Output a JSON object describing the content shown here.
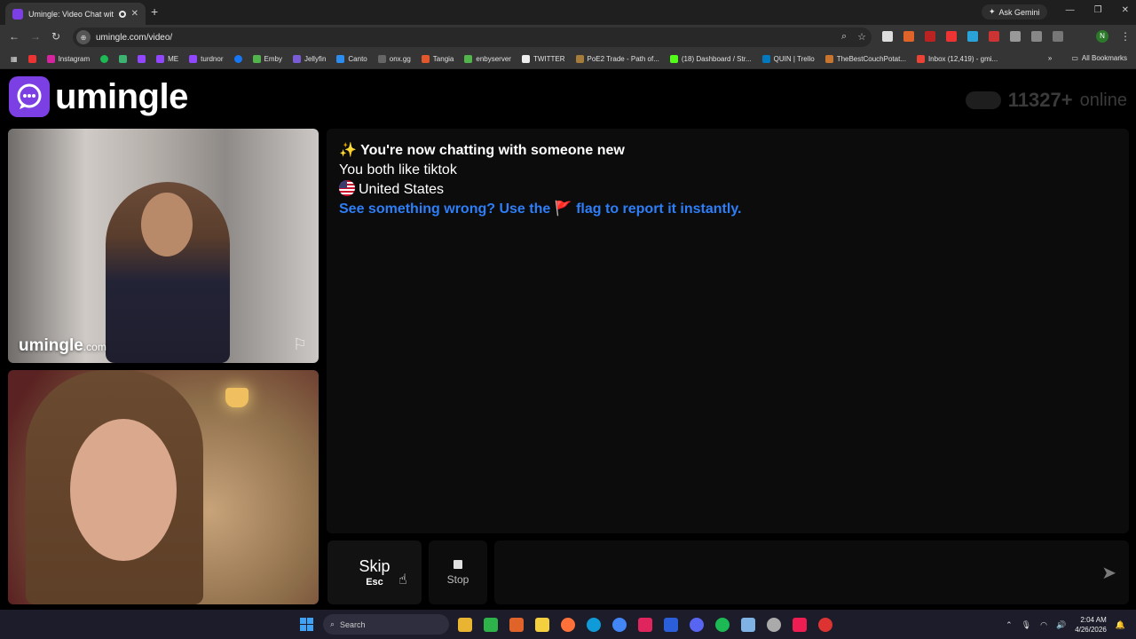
{
  "browser": {
    "tab_title": "Umingle: Video Chat with S",
    "new_tab": "+",
    "ask_gemini": "Ask Gemini",
    "url": "umingle.com/video/",
    "profile_initial": "N",
    "bookmarks": [
      "Instagram",
      "ME",
      "turdnor",
      "Emby",
      "Jellyfin",
      "Canto",
      "onx.gg",
      "Tangia",
      "enbyserver",
      "TWITTER",
      "PoE2 Trade - Path of...",
      "(18) Dashboard / Str...",
      "QUIN | Trello",
      "TheBestCouchPotat...",
      "Inbox (12,419) - gmi..."
    ],
    "all_bookmarks": "All Bookmarks"
  },
  "site": {
    "logo_text": "umingle",
    "online_count": "11327+",
    "online_label": "online",
    "watermark_main": "umingle",
    "watermark_suffix": ".com"
  },
  "chat": {
    "title_emoji": "✨",
    "title": "You're now chatting with someone new",
    "interests": "You both like tiktok",
    "country": "United States",
    "report_prefix": "See something wrong? Use the",
    "report_flag": "🚩",
    "report_suffix": "flag to report it instantly."
  },
  "controls": {
    "skip_label": "Skip",
    "skip_key": "Esc",
    "stop_label": "Stop",
    "message_placeholder": ""
  },
  "taskbar": {
    "search_label": "Search",
    "time": "2:04 AM",
    "date": "4/26/2026"
  },
  "colors": {
    "brand_purple": "#7b3fe4",
    "link_blue": "#2d7ef7"
  }
}
